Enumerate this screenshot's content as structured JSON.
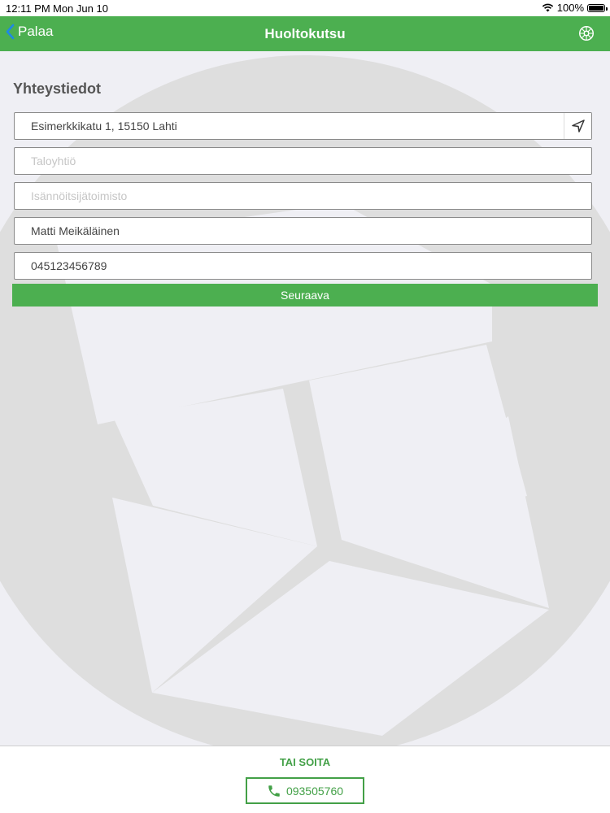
{
  "status_bar": {
    "time": "12:11 PM",
    "date": "Mon Jun 10",
    "battery": "100%"
  },
  "nav": {
    "back_label": "Palaa",
    "title": "Huoltokutsu"
  },
  "form": {
    "section_title": "Yhteystiedot",
    "address": {
      "value": "Esimerkkikatu 1, 15150 Lahti",
      "placeholder": ""
    },
    "housing_company": {
      "value": "",
      "placeholder": "Taloyhtiö"
    },
    "property_manager": {
      "value": "",
      "placeholder": "Isännöitsijätoimisto"
    },
    "name": {
      "value": "Matti Meikäläinen",
      "placeholder": ""
    },
    "phone": {
      "value": "045123456789",
      "placeholder": ""
    },
    "next_label": "Seuraava"
  },
  "footer": {
    "or_call_label": "TAI SOITA",
    "phone_number": "093505760"
  },
  "colors": {
    "primary_green": "#4caf50",
    "accent_green": "#43a047",
    "background": "#efeff4"
  }
}
